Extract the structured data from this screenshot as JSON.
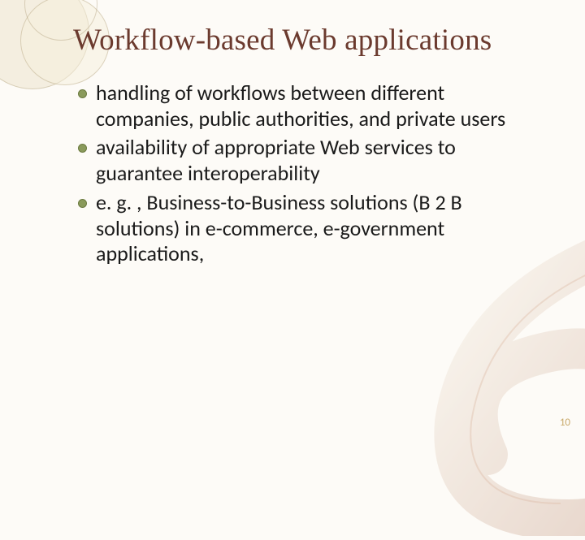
{
  "title": "Workflow-based Web applications",
  "bullets": [
    "handling of workflows between different companies, public authorities, and private users",
    "availability of appropriate Web services to guarantee interoperability",
    "e. g. , Business-to-Business solutions (B 2 B solutions) in e-commerce, e-government applications,"
  ],
  "page_number": "10"
}
